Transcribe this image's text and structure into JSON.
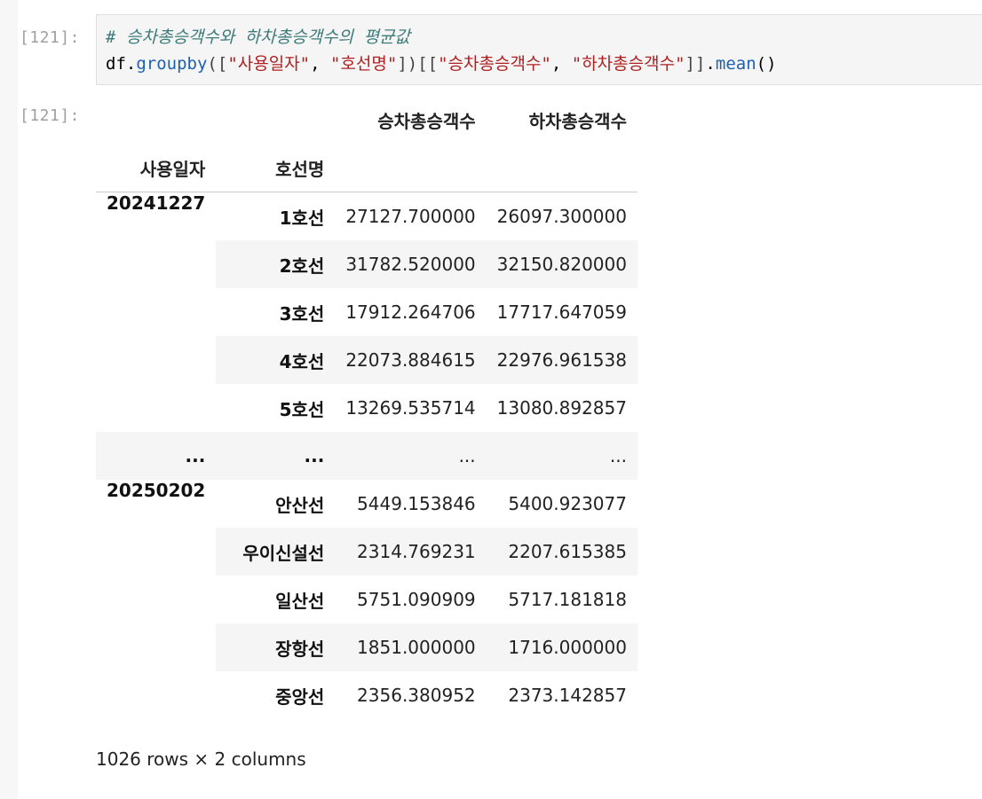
{
  "cell_in": {
    "prompt": "[121]:",
    "comment": "# 승차총승객수와 하차총승객수의 평균값",
    "code": {
      "var": "df",
      "dot1": ".",
      "method1": "groupby",
      "open": "([",
      "key1": "\"사용일자\"",
      "sep": ", ",
      "key2": "\"호선명\"",
      "close1": "])[[",
      "col1": "\"승차총승객수\"",
      "col2": "\"하차총승객수\"",
      "close2": "]]",
      "dot2": ".",
      "method2": "mean",
      "call": "()"
    }
  },
  "cell_out": {
    "prompt": "[121]:",
    "columns": [
      "승차총승객수",
      "하차총승객수"
    ],
    "index_names": [
      "사용일자",
      "호선명"
    ],
    "rows": [
      {
        "date": "20241227",
        "line": "1호선",
        "v1": "27127.700000",
        "v2": "26097.300000"
      },
      {
        "date": "",
        "line": "2호선",
        "v1": "31782.520000",
        "v2": "32150.820000"
      },
      {
        "date": "",
        "line": "3호선",
        "v1": "17912.264706",
        "v2": "17717.647059"
      },
      {
        "date": "",
        "line": "4호선",
        "v1": "22073.884615",
        "v2": "22976.961538"
      },
      {
        "date": "",
        "line": "5호선",
        "v1": "13269.535714",
        "v2": "13080.892857"
      },
      {
        "date": "...",
        "line": "...",
        "v1": "...",
        "v2": "..."
      },
      {
        "date": "20250202",
        "line": "안산선",
        "v1": "5449.153846",
        "v2": "5400.923077"
      },
      {
        "date": "",
        "line": "우이신설선",
        "v1": "2314.769231",
        "v2": "2207.615385"
      },
      {
        "date": "",
        "line": "일산선",
        "v1": "5751.090909",
        "v2": "5717.181818"
      },
      {
        "date": "",
        "line": "장항선",
        "v1": "1851.000000",
        "v2": "1716.000000"
      },
      {
        "date": "",
        "line": "중앙선",
        "v1": "2356.380952",
        "v2": "2373.142857"
      }
    ],
    "summary": "1026 rows × 2 columns"
  }
}
